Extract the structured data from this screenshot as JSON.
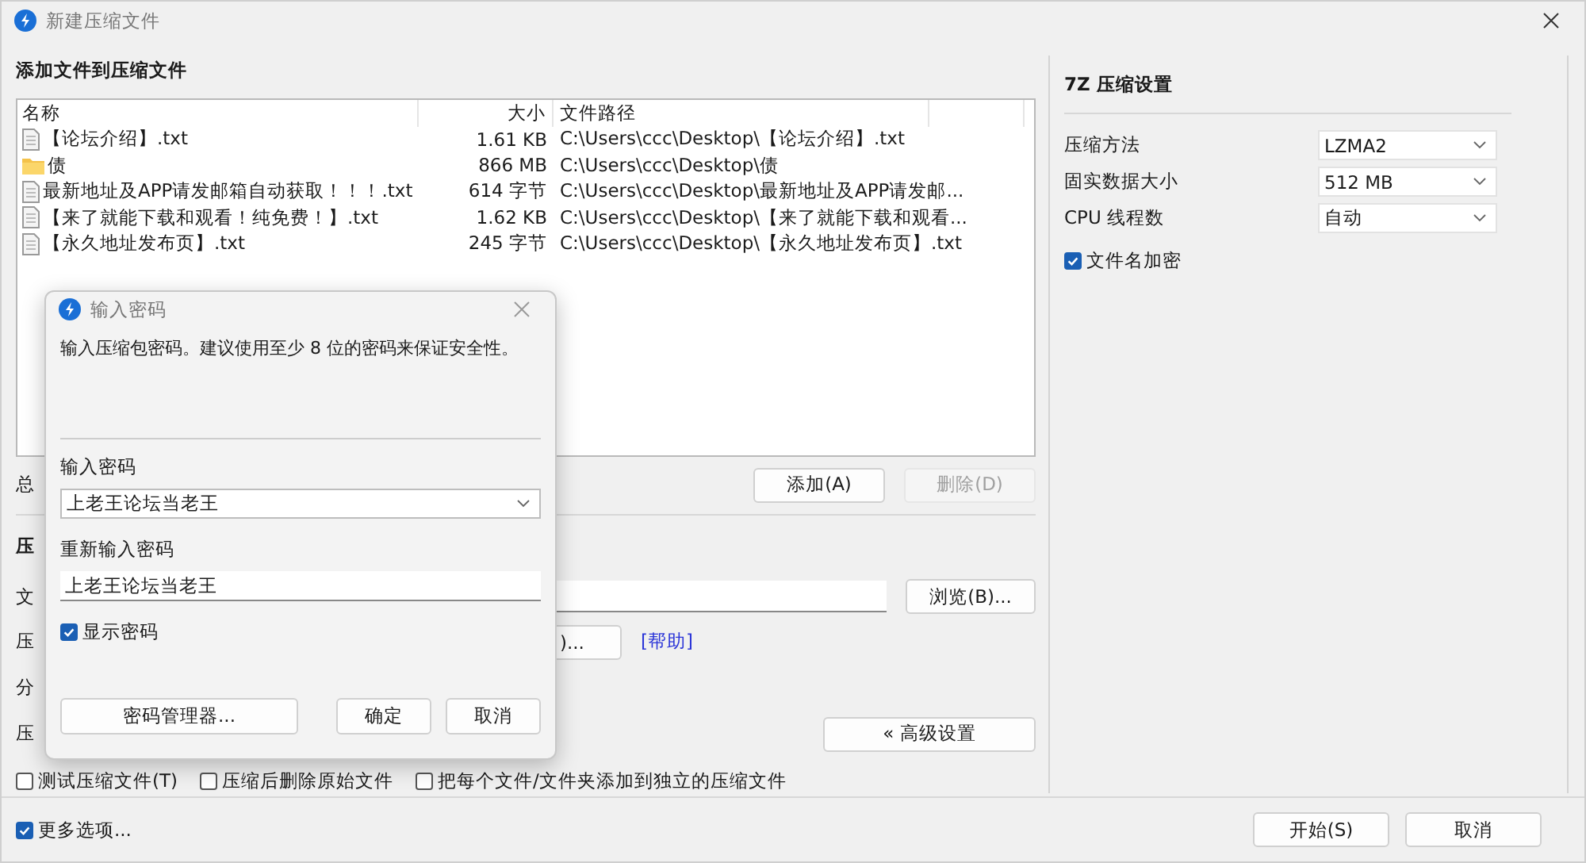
{
  "window": {
    "title": "新建压缩文件"
  },
  "files_section": {
    "heading": "添加文件到压缩文件",
    "columns": [
      "名称",
      "大小",
      "文件路径"
    ],
    "rows": [
      {
        "kind": "file",
        "name": "【论坛介绍】.txt",
        "size": "1.61 KB",
        "path": "C:\\Users\\ccc\\Desktop\\【论坛介绍】.txt"
      },
      {
        "kind": "folder",
        "name": "债",
        "size": "866 MB",
        "path": "C:\\Users\\ccc\\Desktop\\债"
      },
      {
        "kind": "file",
        "name": "最新地址及APP请发邮箱自动获取！！！.txt",
        "size": "614 字节",
        "path": "C:\\Users\\ccc\\Desktop\\最新地址及APP请发邮..."
      },
      {
        "kind": "file",
        "name": "【来了就能下载和观看！纯免费！】.txt",
        "size": "1.62 KB",
        "path": "C:\\Users\\ccc\\Desktop\\【来了就能下载和观看..."
      },
      {
        "kind": "file",
        "name": "【永久地址发布页】.txt",
        "size": "245 字节",
        "path": "C:\\Users\\ccc\\Desktop\\【永久地址发布页】.txt"
      }
    ],
    "total_label": "总",
    "buttons": [
      {
        "label": "添加(A)",
        "disabled": false
      },
      {
        "label": "删除(D)",
        "disabled": true
      }
    ]
  },
  "options_section": {
    "heading": "压",
    "rows": [
      {
        "kind": "field",
        "label": "文",
        "button": "浏览(B)..."
      },
      {
        "kind": "button",
        "label": "压",
        "button": ")...",
        "link": "[帮助]"
      },
      {
        "kind": "plain",
        "label": "分"
      },
      {
        "kind": "wide_button",
        "label": "压",
        "button": "« 高级设置"
      }
    ]
  },
  "checkboxes": [
    {
      "label": "测试压缩文件(T)",
      "checked": false
    },
    {
      "label": "压缩后删除原始文件",
      "checked": false
    },
    {
      "label": "把每个文件/文件夹添加到独立的压缩文件",
      "checked": false
    }
  ],
  "settings": {
    "heading": "7Z 压缩设置",
    "rows": [
      {
        "label": "压缩方法",
        "value": "LZMA2"
      },
      {
        "label": "固实数据大小",
        "value": "512 MB"
      },
      {
        "label": "CPU 线程数",
        "value": "自动"
      }
    ],
    "encrypt_names": {
      "label": "文件名加密",
      "checked": true
    }
  },
  "more_options": {
    "label": "更多选项...",
    "checked": true
  },
  "footer_buttons": [
    "开始(S)",
    "取消"
  ],
  "password_dialog": {
    "title": "输入密码",
    "message": "输入压缩包密码。建议使用至少 8 位的密码来保证安全性。",
    "password_label": "输入密码",
    "password": "上老王论坛当老王",
    "confirm_label": "重新输入密码",
    "confirm": "上老王论坛当老王",
    "show_password": {
      "label": "显示密码",
      "checked": true
    },
    "manager_button": "密码管理器...",
    "ok_button": "确定",
    "cancel_button": "取消"
  }
}
